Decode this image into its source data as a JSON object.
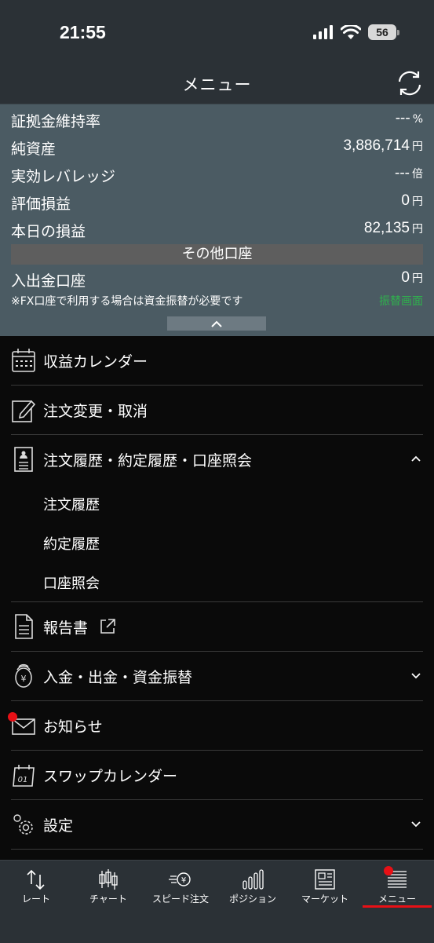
{
  "status": {
    "time": "21:55",
    "battery": "56"
  },
  "header": {
    "title": "メニュー",
    "refresh_icon": "refresh-icon"
  },
  "account": {
    "rows": [
      {
        "label": "証拠金維持率",
        "value": "---",
        "unit": "%"
      },
      {
        "label": "純資産",
        "value": "3,886,714",
        "unit": "円"
      },
      {
        "label": "実効レバレッジ",
        "value": "---",
        "unit": "倍"
      },
      {
        "label": "評価損益",
        "value": "0",
        "unit": "円"
      },
      {
        "label": "本日の損益",
        "value": "82,135",
        "unit": "円"
      }
    ],
    "other_accounts_label": "その他口座",
    "deposit_row": {
      "label": "入出金口座",
      "value": "0",
      "unit": "円"
    },
    "note": "※FX口座で利用する場合は資金振替が必要です",
    "transfer_link": "振替画面",
    "transfer_color": "#2fb04d"
  },
  "menu": {
    "items": [
      {
        "label": "収益カレンダー",
        "icon": "calendar-icon"
      },
      {
        "label": "注文変更・取消",
        "icon": "edit-icon"
      },
      {
        "label": "注文履歴・約定履歴・口座照会",
        "icon": "history-document-icon",
        "expanded": true
      },
      {
        "label": "報告書",
        "icon": "document-icon",
        "external_icon": "external-link-icon"
      },
      {
        "label": "入金・出金・資金振替",
        "icon": "yen-coins-icon"
      },
      {
        "label": "お知らせ",
        "icon": "mail-icon",
        "badge": true
      },
      {
        "label": "スワップカレンダー",
        "icon": "swap-calendar-icon"
      },
      {
        "label": "設定",
        "icon": "gear-icon"
      }
    ],
    "sub_items": [
      "注文履歴",
      "約定履歴",
      "口座照会"
    ]
  },
  "tabbar": {
    "tabs": [
      {
        "label": "レート",
        "icon": "rate-arrows-icon"
      },
      {
        "label": "チャート",
        "icon": "candlestick-icon"
      },
      {
        "label": "スピード注文",
        "icon": "speed-order-icon"
      },
      {
        "label": "ポジション",
        "icon": "position-bars-icon"
      },
      {
        "label": "マーケット",
        "icon": "news-icon"
      },
      {
        "label": "メニュー",
        "icon": "menu-lines-icon",
        "active": true
      }
    ],
    "accent": "#e81016"
  }
}
